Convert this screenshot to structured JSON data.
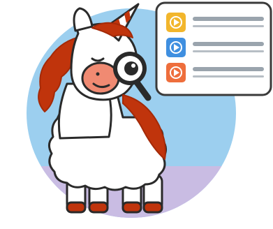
{
  "colors": {
    "background": "#ffffff",
    "circle_sky": "#9ccfef",
    "circle_ground": "#c9bce3",
    "outline": "#2a2a2a",
    "llama_fur": "#ffffff",
    "mane": "#c0340c",
    "mane_dark": "#a42a08",
    "cheek": "#f08a72",
    "horn_stripe": "#c0340c",
    "lens": "#ffffff",
    "card_bg": "#ffffff",
    "card_border": "#3a3a3a",
    "card_item_1": "#f2b62c",
    "card_item_2": "#3f8fe0",
    "card_item_3": "#ee6e3c",
    "card_line": "#9aa4ad",
    "card_line_short": "#b7bec5"
  },
  "illustration": {
    "subject": "unicorn-llama-with-magnifying-glass",
    "card": {
      "rows": [
        {
          "icon": "play-icon",
          "color_key": "card_item_1"
        },
        {
          "icon": "play-icon",
          "color_key": "card_item_2"
        },
        {
          "icon": "play-icon",
          "color_key": "card_item_3"
        }
      ]
    }
  }
}
